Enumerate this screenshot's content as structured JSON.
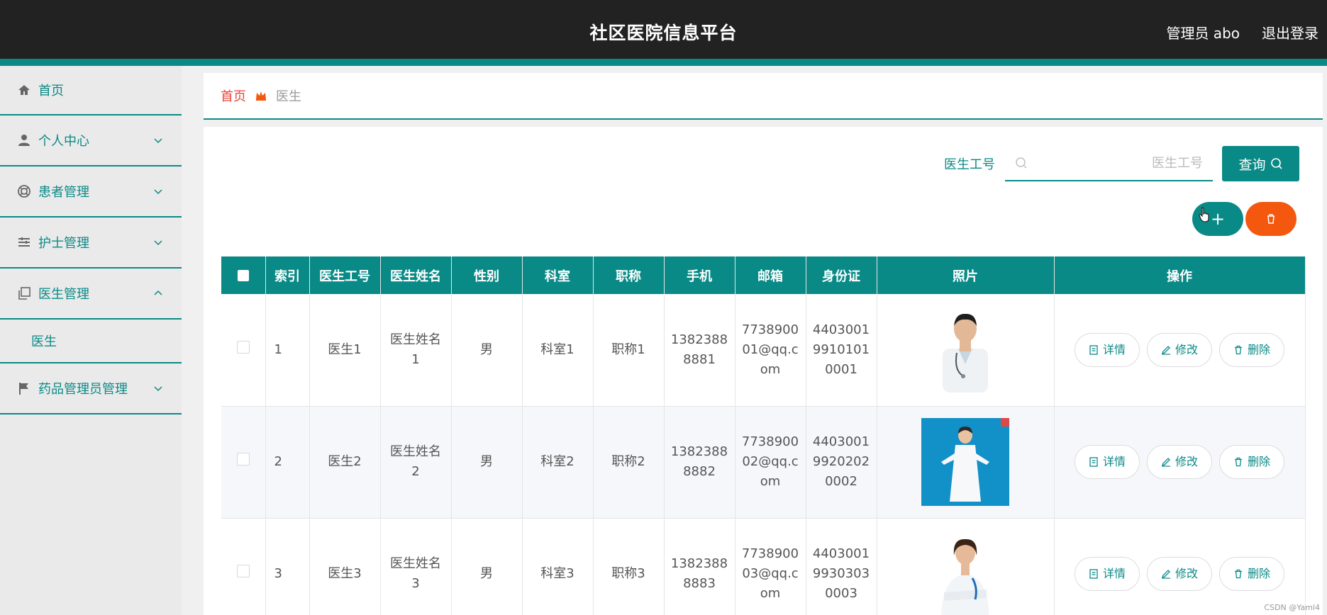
{
  "header": {
    "title": "社区医院信息平台",
    "user": "管理员 abo",
    "logout": "退出登录"
  },
  "sidebar": {
    "items": [
      {
        "label": "首页"
      },
      {
        "label": "个人中心"
      },
      {
        "label": "患者管理"
      },
      {
        "label": "护士管理"
      },
      {
        "label": "医生管理"
      },
      {
        "label": "医生"
      },
      {
        "label": "药品管理员管理"
      }
    ]
  },
  "breadcrumb": {
    "home": "首页",
    "current": "医生"
  },
  "search": {
    "label": "医生工号",
    "placeholder": "医生工号",
    "button": "查询"
  },
  "actions": {
    "add": "+"
  },
  "table": {
    "headers": [
      "索引",
      "医生工号",
      "医生姓名",
      "性别",
      "科室",
      "职称",
      "手机",
      "邮箱",
      "身份证",
      "照片",
      "操作"
    ],
    "rows": [
      {
        "index": "1",
        "id": "医生1",
        "name": "医生姓名1",
        "gender": "男",
        "dept": "科室1",
        "title": "职称1",
        "phone": "13823888881",
        "email": "773890001@qq.com",
        "idcard": "440300199101010001"
      },
      {
        "index": "2",
        "id": "医生2",
        "name": "医生姓名2",
        "gender": "男",
        "dept": "科室2",
        "title": "职称2",
        "phone": "13823888882",
        "email": "773890002@qq.com",
        "idcard": "440300199202020002"
      },
      {
        "index": "3",
        "id": "医生3",
        "name": "医生姓名3",
        "gender": "男",
        "dept": "科室3",
        "title": "职称3",
        "phone": "13823888883",
        "email": "773890003@qq.com",
        "idcard": "440300199303030003"
      }
    ],
    "ops": {
      "detail": "详情",
      "edit": "修改",
      "delete": "删除"
    }
  },
  "watermark": "CSDN @Yaml4",
  "colors": {
    "accent": "#0a8a87",
    "danger": "#f4580f",
    "header": "#222222",
    "home_link": "#e8433b"
  }
}
